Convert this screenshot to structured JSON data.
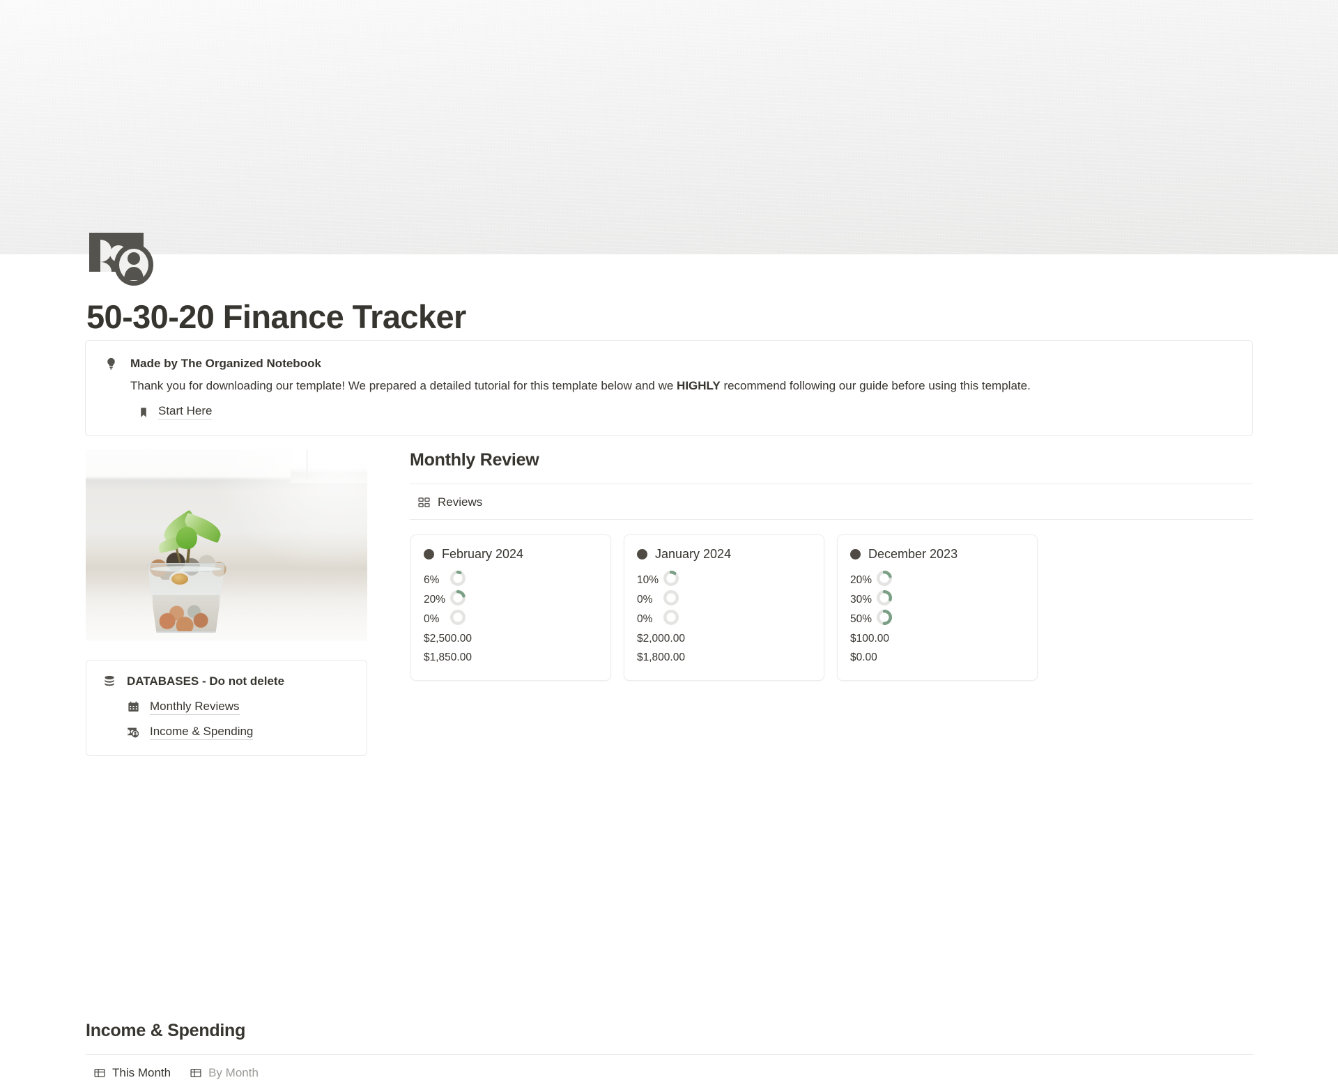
{
  "cover": {
    "icon_name": "money-person-icon"
  },
  "page": {
    "title": "50-30-20 Finance Tracker"
  },
  "callout": {
    "icon_name": "lightbulb-icon",
    "title": "Made by The Organized Notebook",
    "text_before": "Thank you for downloading our template! We prepared a detailed tutorial for this template below and we ",
    "text_bold": "HIGHLY",
    "text_after": " recommend following our guide before using this template.",
    "link_icon_name": "bookmark-icon",
    "link_label": "Start Here"
  },
  "left_column": {
    "image_alt": "plant growing in glass of coins",
    "databases": {
      "icon_name": "database-icon",
      "title": "DATABASES - Do not delete",
      "items": [
        {
          "icon_name": "calendar-icon",
          "label": "Monthly Reviews"
        },
        {
          "icon_name": "money-person-icon",
          "label": "Income & Spending"
        }
      ]
    }
  },
  "monthly_review": {
    "title": "Monthly Review",
    "view_tab": {
      "icon_name": "gallery-view-icon",
      "label": "Reviews"
    },
    "cards": [
      {
        "title": "February 2024",
        "dot_color": "#4f4a43",
        "progress": [
          {
            "label": "6%",
            "value": 6
          },
          {
            "label": "20%",
            "value": 20
          },
          {
            "label": "0%",
            "value": 0
          }
        ],
        "amounts": [
          "$2,500.00",
          "$1,850.00"
        ]
      },
      {
        "title": "January 2024",
        "dot_color": "#4f4a43",
        "progress": [
          {
            "label": "10%",
            "value": 10
          },
          {
            "label": "0%",
            "value": 0
          },
          {
            "label": "0%",
            "value": 0
          }
        ],
        "amounts": [
          "$2,000.00",
          "$1,800.00"
        ]
      },
      {
        "title": "December 2023",
        "dot_color": "#4f4a43",
        "progress": [
          {
            "label": "20%",
            "value": 20
          },
          {
            "label": "30%",
            "value": 30
          },
          {
            "label": "50%",
            "value": 50
          }
        ],
        "amounts": [
          "$100.00",
          "$0.00"
        ]
      }
    ]
  },
  "income_spending": {
    "title": "Income & Spending",
    "tabs": [
      {
        "icon_name": "table-view-icon",
        "label": "This Month",
        "active": true
      },
      {
        "icon_name": "table-view-icon",
        "label": "By Month",
        "active": false
      }
    ]
  },
  "colors": {
    "text": "#37352f",
    "muted": "#9b9a97",
    "border": "#e9e9e7",
    "ring_track": "#e4e4e2",
    "ring_fill": "#7a9f85",
    "dot": "#4f4a43"
  }
}
